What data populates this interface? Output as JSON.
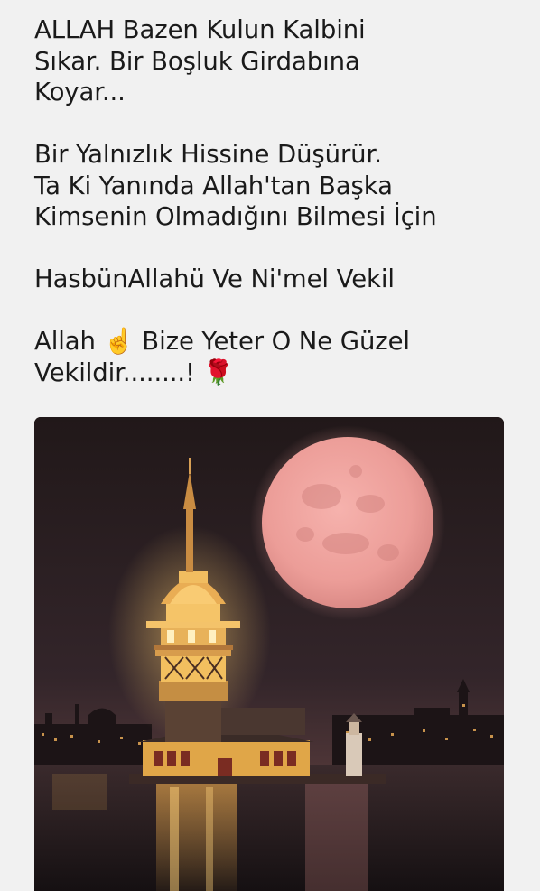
{
  "post": {
    "paragraphs": [
      {
        "lines": [
          "ALLAH Bazen Kulun Kalbini",
          "Sıkar. Bir Boşluk Girdabına",
          "Koyar..."
        ]
      },
      {
        "lines": [
          "Bir Yalnızlık Hissine Düşürür.",
          "Ta Ki Yanında Allah'tan Başka",
          "Kimsenin Olmadığını Bilmesi İçin"
        ]
      },
      {
        "lines": [
          "HasbünAllahü Ve Ni'mel Vekil"
        ]
      },
      {
        "lines": [
          "Allah ☝️ Bize Yeter O Ne Güzel",
          "Vekildir........! 🌹"
        ]
      }
    ]
  },
  "image": {
    "subject": "maidens-tower-full-moon-night",
    "colors": {
      "sky_top": "#241b1c",
      "sky_bottom": "#4a3430",
      "moon": "#f0a3a0",
      "tower_light": "#f6c25a",
      "water": "#1e1719"
    }
  }
}
